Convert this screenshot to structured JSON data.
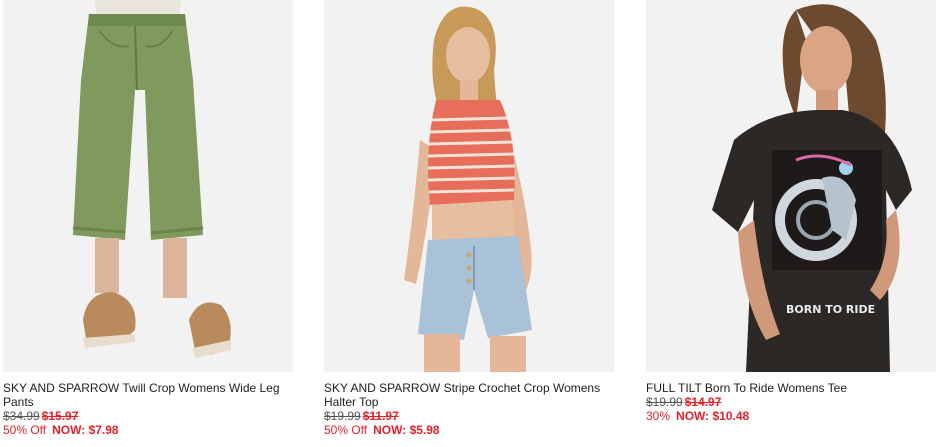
{
  "products": [
    {
      "title": "SKY AND SPARROW Twill Crop Womens Wide Leg Pants",
      "original_price": "$34.99",
      "sale_price": "$15.97",
      "discount": "50% Off",
      "now_price": "NOW: $7.98",
      "image": "green-wide-leg-pants-photo"
    },
    {
      "title": "SKY AND SPARROW Stripe Crochet Crop Womens Halter Top",
      "original_price": "$19.99",
      "sale_price": "$11.97",
      "discount": "50% Off",
      "now_price": "NOW: $5.98",
      "image": "striped-halter-top-photo"
    },
    {
      "title": "FULL TILT Born To Ride Womens Tee",
      "original_price": "$19.99",
      "sale_price": "$14.97",
      "discount": "30%",
      "now_price": "NOW: $10.48",
      "image": "black-graphic-tee-photo",
      "graphic_text": "BORN TO RIDE"
    }
  ],
  "colors": {
    "sale_red": "#e8202a",
    "title_text": "#222222",
    "image_bg": "#f2f2f2"
  }
}
